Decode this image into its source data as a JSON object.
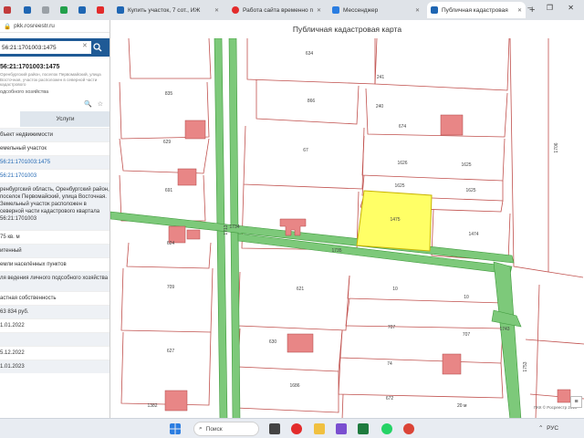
{
  "browser": {
    "tabs": [
      {
        "label": "",
        "icon_color": "#c23b3b"
      },
      {
        "label": "",
        "icon_color": "#1f66b3"
      },
      {
        "label": "",
        "icon_color": "#22a04b"
      },
      {
        "label": "",
        "icon_color": "#1f66b3"
      },
      {
        "label": "",
        "icon_color": "#e32b2b"
      },
      {
        "label": "Купить участок, 7 сот., ИЖ",
        "icon_color": "#1f66b3"
      },
      {
        "label": "Работа сайта временно п",
        "icon_color": "#e32b2b"
      },
      {
        "label": "Мессенджер",
        "icon_color": "#2a7de1"
      },
      {
        "label": "Публичная кадастровая",
        "icon_color": "#1f66b3"
      }
    ],
    "new_tab": "+",
    "window_controls": "– ❐ ✕",
    "address": "pkk.rosreestr.ru"
  },
  "panel": {
    "search_value": "56:21:1701003:1475",
    "search_clear": "✕",
    "collapse": "‹",
    "object_number": "56:21:1701003:1475",
    "object_desc": "Оренбургский район, поселок Первомайский, улица Восточная, участок расположен в северной части кадастрового",
    "object_type_line": "одсобного хозяйства",
    "tab_services": "Услуги",
    "rows": [
      {
        "text": "бъект недвижимости",
        "shade": true
      },
      {
        "text": "емельный участок",
        "shade": false
      },
      {
        "text": "56:21:1701003:1475",
        "shade": true,
        "link": true
      },
      {
        "text": "56:21:1701003",
        "shade": false,
        "link": true
      },
      {
        "text": "ренбургский область, Оренбургский район, поселок Первомайский, улица Восточная. Земельный участок расположен в северной части кадастрового квартала 56:21:1701003",
        "shade": true
      },
      {
        "text": "75 кв. м",
        "shade": false
      },
      {
        "text": "итенный",
        "shade": true
      },
      {
        "text": "емли населённых пунктов",
        "shade": false
      },
      {
        "text": "ля ведения личного подсобного хозяйства",
        "shade": true
      },
      {
        "text": "астная собственность",
        "shade": false
      },
      {
        "text": "63 834 руб.",
        "shade": true
      },
      {
        "text": "1.01.2022",
        "shade": false
      },
      {
        "text": "",
        "shade": true
      },
      {
        "text": "5.12.2022",
        "shade": false
      },
      {
        "text": "1.01.2023",
        "shade": true
      }
    ]
  },
  "map": {
    "title": "Публичная кадастровая карта",
    "scale": "20 м",
    "copyright": "ПКК © Росреестр 2010",
    "legend": "≡",
    "colors": {
      "parcel_border": "#c0504d",
      "road": "#7dc97a",
      "road_border": "#3f9a3c",
      "building": "#e88686",
      "selected": "#ffff66",
      "selected_border": "#c8b400"
    },
    "labels": {
      "p634": "634",
      "p241": "241",
      "p835": "835",
      "p866": "866",
      "p240": "240",
      "p674": "674",
      "p629": "629",
      "p67": "67",
      "p1626": "1626",
      "p1625a": "1625",
      "p1625b": "1625",
      "p1625c": "1625",
      "p691": "691",
      "p1475": "1475",
      "p1474": "1474",
      "p1735": "1735",
      "p1734": "1734",
      "p624": "624",
      "p709": "709",
      "p621": "621",
      "p10a": "10",
      "p10b": "10",
      "p707a": "707",
      "p707b": "707",
      "p630": "630",
      "p74": "74",
      "p627": "627",
      "p1686": "1686",
      "p672": "672",
      "p1382": "1382",
      "p1706": "1706",
      "p1713": "1713",
      "p1753": "1753",
      "p1743": "1743"
    }
  },
  "taskbar": {
    "search_label": "Поиск",
    "lang": "РУС",
    "tray_icon": "⌃"
  }
}
